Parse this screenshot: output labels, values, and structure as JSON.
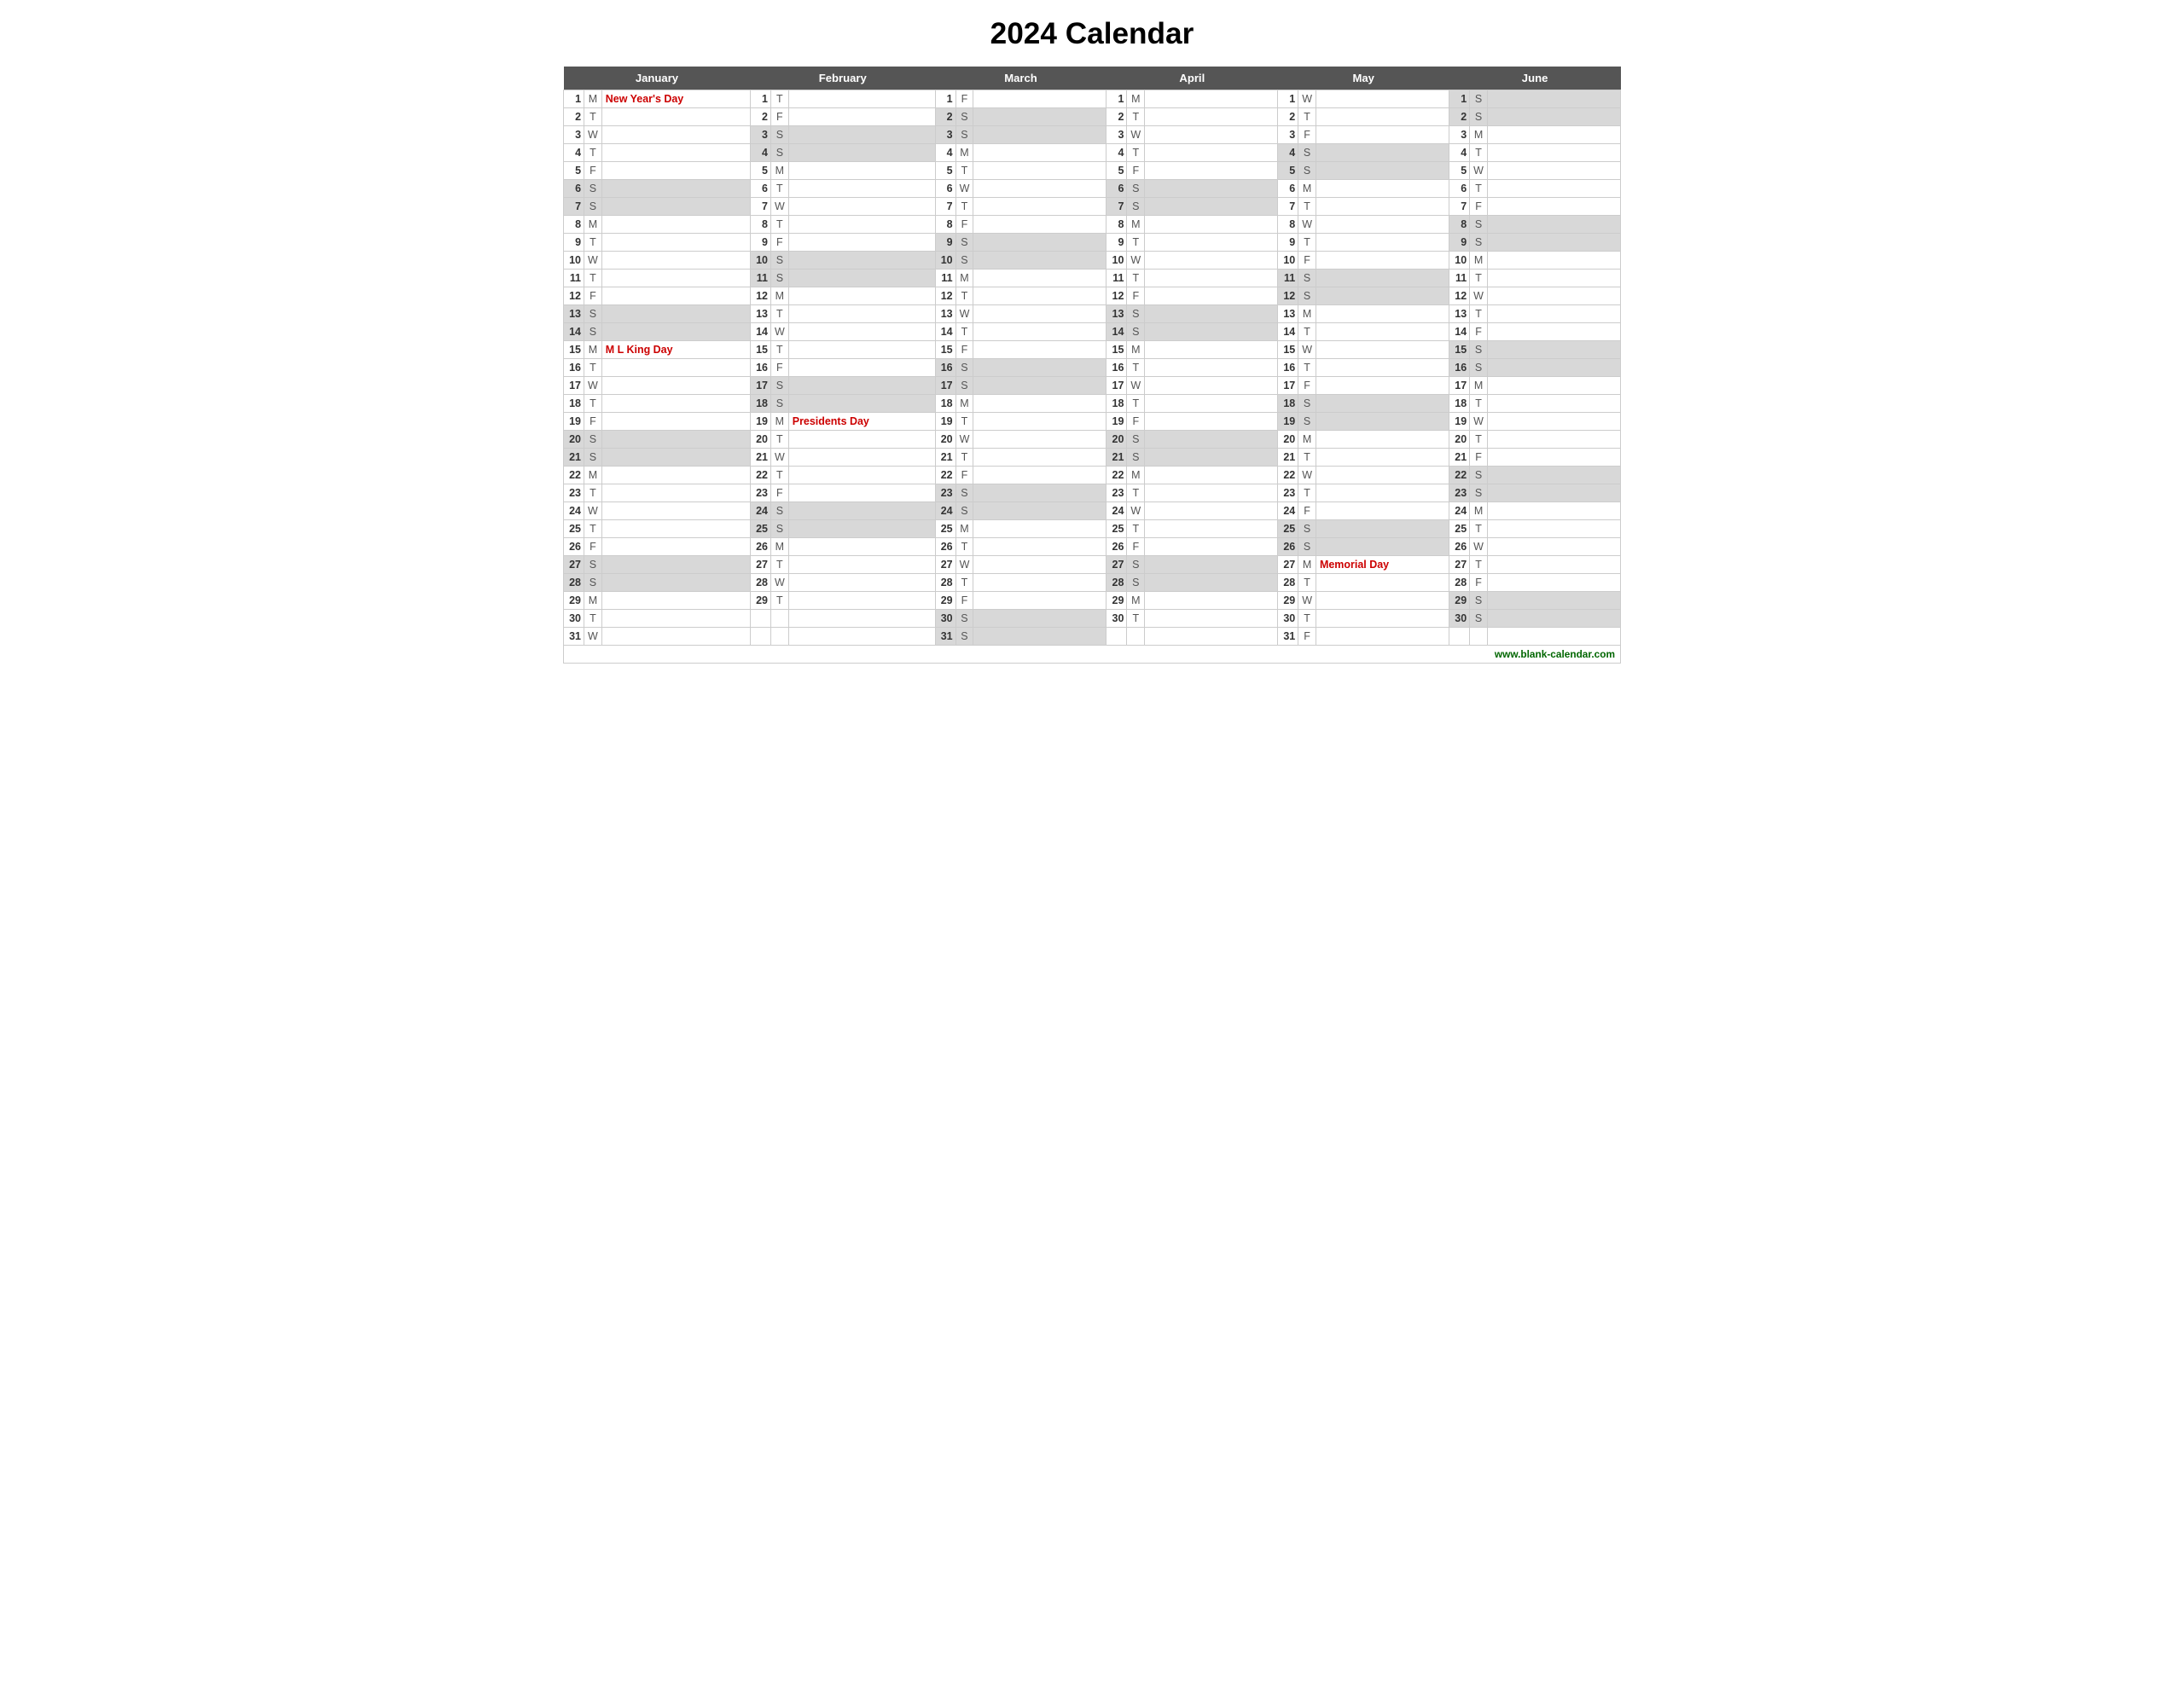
{
  "title": "2024 Calendar",
  "months": [
    "January",
    "February",
    "March",
    "April",
    "May",
    "June"
  ],
  "footer": "www.blank-calendar.com",
  "days": {
    "january": [
      {
        "d": 1,
        "w": "M",
        "event": "New Year's Day",
        "holiday": true
      },
      {
        "d": 2,
        "w": "T",
        "event": "",
        "holiday": false
      },
      {
        "d": 3,
        "w": "W",
        "event": "",
        "holiday": false
      },
      {
        "d": 4,
        "w": "T",
        "event": "",
        "holiday": false
      },
      {
        "d": 5,
        "w": "F",
        "event": "",
        "holiday": false
      },
      {
        "d": 6,
        "w": "S",
        "event": "",
        "holiday": false,
        "weekend": true
      },
      {
        "d": 7,
        "w": "S",
        "event": "",
        "holiday": false,
        "weekend": true
      },
      {
        "d": 8,
        "w": "M",
        "event": "",
        "holiday": false
      },
      {
        "d": 9,
        "w": "T",
        "event": "",
        "holiday": false
      },
      {
        "d": 10,
        "w": "W",
        "event": "",
        "holiday": false
      },
      {
        "d": 11,
        "w": "T",
        "event": "",
        "holiday": false
      },
      {
        "d": 12,
        "w": "F",
        "event": "",
        "holiday": false
      },
      {
        "d": 13,
        "w": "S",
        "event": "",
        "holiday": false,
        "weekend": true
      },
      {
        "d": 14,
        "w": "S",
        "event": "",
        "holiday": false,
        "weekend": true
      },
      {
        "d": 15,
        "w": "M",
        "event": "M L King Day",
        "holiday": true
      },
      {
        "d": 16,
        "w": "T",
        "event": "",
        "holiday": false
      },
      {
        "d": 17,
        "w": "W",
        "event": "",
        "holiday": false
      },
      {
        "d": 18,
        "w": "T",
        "event": "",
        "holiday": false
      },
      {
        "d": 19,
        "w": "F",
        "event": "",
        "holiday": false
      },
      {
        "d": 20,
        "w": "S",
        "event": "",
        "holiday": false,
        "weekend": true
      },
      {
        "d": 21,
        "w": "S",
        "event": "",
        "holiday": false,
        "weekend": true
      },
      {
        "d": 22,
        "w": "M",
        "event": "",
        "holiday": false
      },
      {
        "d": 23,
        "w": "T",
        "event": "",
        "holiday": false
      },
      {
        "d": 24,
        "w": "W",
        "event": "",
        "holiday": false
      },
      {
        "d": 25,
        "w": "T",
        "event": "",
        "holiday": false
      },
      {
        "d": 26,
        "w": "F",
        "event": "",
        "holiday": false
      },
      {
        "d": 27,
        "w": "S",
        "event": "",
        "holiday": false,
        "weekend": true
      },
      {
        "d": 28,
        "w": "S",
        "event": "",
        "holiday": false,
        "weekend": true
      },
      {
        "d": 29,
        "w": "M",
        "event": "",
        "holiday": false
      },
      {
        "d": 30,
        "w": "T",
        "event": "",
        "holiday": false
      },
      {
        "d": 31,
        "w": "W",
        "event": "",
        "holiday": false
      }
    ],
    "february": [
      {
        "d": 1,
        "w": "T",
        "event": "",
        "holiday": false
      },
      {
        "d": 2,
        "w": "F",
        "event": "",
        "holiday": false
      },
      {
        "d": 3,
        "w": "S",
        "event": "",
        "holiday": false,
        "weekend": true
      },
      {
        "d": 4,
        "w": "S",
        "event": "",
        "holiday": false,
        "weekend": true
      },
      {
        "d": 5,
        "w": "M",
        "event": "",
        "holiday": false
      },
      {
        "d": 6,
        "w": "T",
        "event": "",
        "holiday": false
      },
      {
        "d": 7,
        "w": "W",
        "event": "",
        "holiday": false
      },
      {
        "d": 8,
        "w": "T",
        "event": "",
        "holiday": false
      },
      {
        "d": 9,
        "w": "F",
        "event": "",
        "holiday": false
      },
      {
        "d": 10,
        "w": "S",
        "event": "",
        "holiday": false,
        "weekend": true
      },
      {
        "d": 11,
        "w": "S",
        "event": "",
        "holiday": false,
        "weekend": true
      },
      {
        "d": 12,
        "w": "M",
        "event": "",
        "holiday": false
      },
      {
        "d": 13,
        "w": "T",
        "event": "",
        "holiday": false
      },
      {
        "d": 14,
        "w": "W",
        "event": "",
        "holiday": false
      },
      {
        "d": 15,
        "w": "T",
        "event": "",
        "holiday": false
      },
      {
        "d": 16,
        "w": "F",
        "event": "",
        "holiday": false
      },
      {
        "d": 17,
        "w": "S",
        "event": "",
        "holiday": false,
        "weekend": true
      },
      {
        "d": 18,
        "w": "S",
        "event": "",
        "holiday": false,
        "weekend": true
      },
      {
        "d": 19,
        "w": "M",
        "event": "Presidents Day",
        "holiday": true
      },
      {
        "d": 20,
        "w": "T",
        "event": "",
        "holiday": false
      },
      {
        "d": 21,
        "w": "W",
        "event": "",
        "holiday": false
      },
      {
        "d": 22,
        "w": "T",
        "event": "",
        "holiday": false
      },
      {
        "d": 23,
        "w": "F",
        "event": "",
        "holiday": false
      },
      {
        "d": 24,
        "w": "S",
        "event": "",
        "holiday": false,
        "weekend": true
      },
      {
        "d": 25,
        "w": "S",
        "event": "",
        "holiday": false,
        "weekend": true
      },
      {
        "d": 26,
        "w": "M",
        "event": "",
        "holiday": false
      },
      {
        "d": 27,
        "w": "T",
        "event": "",
        "holiday": false
      },
      {
        "d": 28,
        "w": "W",
        "event": "",
        "holiday": false
      },
      {
        "d": 29,
        "w": "T",
        "event": "",
        "holiday": false
      }
    ],
    "march": [
      {
        "d": 1,
        "w": "F",
        "event": "",
        "holiday": false
      },
      {
        "d": 2,
        "w": "S",
        "event": "",
        "holiday": false,
        "weekend": true
      },
      {
        "d": 3,
        "w": "S",
        "event": "",
        "holiday": false,
        "weekend": true
      },
      {
        "d": 4,
        "w": "M",
        "event": "",
        "holiday": false
      },
      {
        "d": 5,
        "w": "T",
        "event": "",
        "holiday": false
      },
      {
        "d": 6,
        "w": "W",
        "event": "",
        "holiday": false
      },
      {
        "d": 7,
        "w": "T",
        "event": "",
        "holiday": false
      },
      {
        "d": 8,
        "w": "F",
        "event": "",
        "holiday": false
      },
      {
        "d": 9,
        "w": "S",
        "event": "",
        "holiday": false,
        "weekend": true
      },
      {
        "d": 10,
        "w": "S",
        "event": "",
        "holiday": false,
        "weekend": true
      },
      {
        "d": 11,
        "w": "M",
        "event": "",
        "holiday": false
      },
      {
        "d": 12,
        "w": "T",
        "event": "",
        "holiday": false
      },
      {
        "d": 13,
        "w": "W",
        "event": "",
        "holiday": false
      },
      {
        "d": 14,
        "w": "T",
        "event": "",
        "holiday": false
      },
      {
        "d": 15,
        "w": "F",
        "event": "",
        "holiday": false
      },
      {
        "d": 16,
        "w": "S",
        "event": "",
        "holiday": false,
        "weekend": true
      },
      {
        "d": 17,
        "w": "S",
        "event": "",
        "holiday": false,
        "weekend": true
      },
      {
        "d": 18,
        "w": "M",
        "event": "",
        "holiday": false
      },
      {
        "d": 19,
        "w": "T",
        "event": "",
        "holiday": false
      },
      {
        "d": 20,
        "w": "W",
        "event": "",
        "holiday": false
      },
      {
        "d": 21,
        "w": "T",
        "event": "",
        "holiday": false
      },
      {
        "d": 22,
        "w": "F",
        "event": "",
        "holiday": false
      },
      {
        "d": 23,
        "w": "S",
        "event": "",
        "holiday": false,
        "weekend": true
      },
      {
        "d": 24,
        "w": "S",
        "event": "",
        "holiday": false,
        "weekend": true
      },
      {
        "d": 25,
        "w": "M",
        "event": "",
        "holiday": false
      },
      {
        "d": 26,
        "w": "T",
        "event": "",
        "holiday": false
      },
      {
        "d": 27,
        "w": "W",
        "event": "",
        "holiday": false
      },
      {
        "d": 28,
        "w": "T",
        "event": "",
        "holiday": false
      },
      {
        "d": 29,
        "w": "F",
        "event": "",
        "holiday": false
      },
      {
        "d": 30,
        "w": "S",
        "event": "",
        "holiday": false,
        "weekend": true
      },
      {
        "d": 31,
        "w": "S",
        "event": "",
        "holiday": false,
        "weekend": true
      }
    ],
    "april": [
      {
        "d": 1,
        "w": "M",
        "event": "",
        "holiday": false
      },
      {
        "d": 2,
        "w": "T",
        "event": "",
        "holiday": false
      },
      {
        "d": 3,
        "w": "W",
        "event": "",
        "holiday": false
      },
      {
        "d": 4,
        "w": "T",
        "event": "",
        "holiday": false
      },
      {
        "d": 5,
        "w": "F",
        "event": "",
        "holiday": false
      },
      {
        "d": 6,
        "w": "S",
        "event": "",
        "holiday": false,
        "weekend": true
      },
      {
        "d": 7,
        "w": "S",
        "event": "",
        "holiday": false,
        "weekend": true
      },
      {
        "d": 8,
        "w": "M",
        "event": "",
        "holiday": false
      },
      {
        "d": 9,
        "w": "T",
        "event": "",
        "holiday": false
      },
      {
        "d": 10,
        "w": "W",
        "event": "",
        "holiday": false
      },
      {
        "d": 11,
        "w": "T",
        "event": "",
        "holiday": false
      },
      {
        "d": 12,
        "w": "F",
        "event": "",
        "holiday": false
      },
      {
        "d": 13,
        "w": "S",
        "event": "",
        "holiday": false,
        "weekend": true
      },
      {
        "d": 14,
        "w": "S",
        "event": "",
        "holiday": false,
        "weekend": true
      },
      {
        "d": 15,
        "w": "M",
        "event": "",
        "holiday": false
      },
      {
        "d": 16,
        "w": "T",
        "event": "",
        "holiday": false
      },
      {
        "d": 17,
        "w": "W",
        "event": "",
        "holiday": false
      },
      {
        "d": 18,
        "w": "T",
        "event": "",
        "holiday": false
      },
      {
        "d": 19,
        "w": "F",
        "event": "",
        "holiday": false
      },
      {
        "d": 20,
        "w": "S",
        "event": "",
        "holiday": false,
        "weekend": true
      },
      {
        "d": 21,
        "w": "S",
        "event": "",
        "holiday": false,
        "weekend": true
      },
      {
        "d": 22,
        "w": "M",
        "event": "",
        "holiday": false
      },
      {
        "d": 23,
        "w": "T",
        "event": "",
        "holiday": false
      },
      {
        "d": 24,
        "w": "W",
        "event": "",
        "holiday": false
      },
      {
        "d": 25,
        "w": "T",
        "event": "",
        "holiday": false
      },
      {
        "d": 26,
        "w": "F",
        "event": "",
        "holiday": false
      },
      {
        "d": 27,
        "w": "S",
        "event": "",
        "holiday": false,
        "weekend": true
      },
      {
        "d": 28,
        "w": "S",
        "event": "",
        "holiday": false,
        "weekend": true
      },
      {
        "d": 29,
        "w": "M",
        "event": "",
        "holiday": false
      },
      {
        "d": 30,
        "w": "T",
        "event": "",
        "holiday": false
      }
    ],
    "may": [
      {
        "d": 1,
        "w": "W",
        "event": "",
        "holiday": false
      },
      {
        "d": 2,
        "w": "T",
        "event": "",
        "holiday": false
      },
      {
        "d": 3,
        "w": "F",
        "event": "",
        "holiday": false
      },
      {
        "d": 4,
        "w": "S",
        "event": "",
        "holiday": false,
        "weekend": true
      },
      {
        "d": 5,
        "w": "S",
        "event": "",
        "holiday": false,
        "weekend": true
      },
      {
        "d": 6,
        "w": "M",
        "event": "",
        "holiday": false
      },
      {
        "d": 7,
        "w": "T",
        "event": "",
        "holiday": false
      },
      {
        "d": 8,
        "w": "W",
        "event": "",
        "holiday": false
      },
      {
        "d": 9,
        "w": "T",
        "event": "",
        "holiday": false
      },
      {
        "d": 10,
        "w": "F",
        "event": "",
        "holiday": false
      },
      {
        "d": 11,
        "w": "S",
        "event": "",
        "holiday": false,
        "weekend": true
      },
      {
        "d": 12,
        "w": "S",
        "event": "",
        "holiday": false,
        "weekend": true
      },
      {
        "d": 13,
        "w": "M",
        "event": "",
        "holiday": false
      },
      {
        "d": 14,
        "w": "T",
        "event": "",
        "holiday": false
      },
      {
        "d": 15,
        "w": "W",
        "event": "",
        "holiday": false
      },
      {
        "d": 16,
        "w": "T",
        "event": "",
        "holiday": false
      },
      {
        "d": 17,
        "w": "F",
        "event": "",
        "holiday": false
      },
      {
        "d": 18,
        "w": "S",
        "event": "",
        "holiday": false,
        "weekend": true
      },
      {
        "d": 19,
        "w": "S",
        "event": "",
        "holiday": false,
        "weekend": true
      },
      {
        "d": 20,
        "w": "M",
        "event": "",
        "holiday": false
      },
      {
        "d": 21,
        "w": "T",
        "event": "",
        "holiday": false
      },
      {
        "d": 22,
        "w": "W",
        "event": "",
        "holiday": false
      },
      {
        "d": 23,
        "w": "T",
        "event": "",
        "holiday": false
      },
      {
        "d": 24,
        "w": "F",
        "event": "",
        "holiday": false
      },
      {
        "d": 25,
        "w": "S",
        "event": "",
        "holiday": false,
        "weekend": true
      },
      {
        "d": 26,
        "w": "S",
        "event": "",
        "holiday": false,
        "weekend": true
      },
      {
        "d": 27,
        "w": "M",
        "event": "Memorial Day",
        "holiday": true
      },
      {
        "d": 28,
        "w": "T",
        "event": "",
        "holiday": false
      },
      {
        "d": 29,
        "w": "W",
        "event": "",
        "holiday": false
      },
      {
        "d": 30,
        "w": "T",
        "event": "",
        "holiday": false
      },
      {
        "d": 31,
        "w": "F",
        "event": "",
        "holiday": false
      }
    ],
    "june": [
      {
        "d": 1,
        "w": "S",
        "event": "",
        "holiday": false,
        "weekend": true
      },
      {
        "d": 2,
        "w": "S",
        "event": "",
        "holiday": false,
        "weekend": true
      },
      {
        "d": 3,
        "w": "M",
        "event": "",
        "holiday": false
      },
      {
        "d": 4,
        "w": "T",
        "event": "",
        "holiday": false
      },
      {
        "d": 5,
        "w": "W",
        "event": "",
        "holiday": false
      },
      {
        "d": 6,
        "w": "T",
        "event": "",
        "holiday": false
      },
      {
        "d": 7,
        "w": "F",
        "event": "",
        "holiday": false
      },
      {
        "d": 8,
        "w": "S",
        "event": "",
        "holiday": false,
        "weekend": true
      },
      {
        "d": 9,
        "w": "S",
        "event": "",
        "holiday": false,
        "weekend": true
      },
      {
        "d": 10,
        "w": "M",
        "event": "",
        "holiday": false
      },
      {
        "d": 11,
        "w": "T",
        "event": "",
        "holiday": false
      },
      {
        "d": 12,
        "w": "W",
        "event": "",
        "holiday": false
      },
      {
        "d": 13,
        "w": "T",
        "event": "",
        "holiday": false
      },
      {
        "d": 14,
        "w": "F",
        "event": "",
        "holiday": false
      },
      {
        "d": 15,
        "w": "S",
        "event": "",
        "holiday": false,
        "weekend": true
      },
      {
        "d": 16,
        "w": "S",
        "event": "",
        "holiday": false,
        "weekend": true
      },
      {
        "d": 17,
        "w": "M",
        "event": "",
        "holiday": false
      },
      {
        "d": 18,
        "w": "T",
        "event": "",
        "holiday": false
      },
      {
        "d": 19,
        "w": "W",
        "event": "",
        "holiday": false
      },
      {
        "d": 20,
        "w": "T",
        "event": "",
        "holiday": false
      },
      {
        "d": 21,
        "w": "F",
        "event": "",
        "holiday": false
      },
      {
        "d": 22,
        "w": "S",
        "event": "",
        "holiday": false,
        "weekend": true
      },
      {
        "d": 23,
        "w": "S",
        "event": "",
        "holiday": false,
        "weekend": true
      },
      {
        "d": 24,
        "w": "M",
        "event": "",
        "holiday": false
      },
      {
        "d": 25,
        "w": "T",
        "event": "",
        "holiday": false
      },
      {
        "d": 26,
        "w": "W",
        "event": "",
        "holiday": false
      },
      {
        "d": 27,
        "w": "T",
        "event": "",
        "holiday": false
      },
      {
        "d": 28,
        "w": "F",
        "event": "",
        "holiday": false
      },
      {
        "d": 29,
        "w": "S",
        "event": "",
        "holiday": false,
        "weekend": true
      },
      {
        "d": 30,
        "w": "S",
        "event": "",
        "holiday": false,
        "weekend": true
      }
    ]
  }
}
